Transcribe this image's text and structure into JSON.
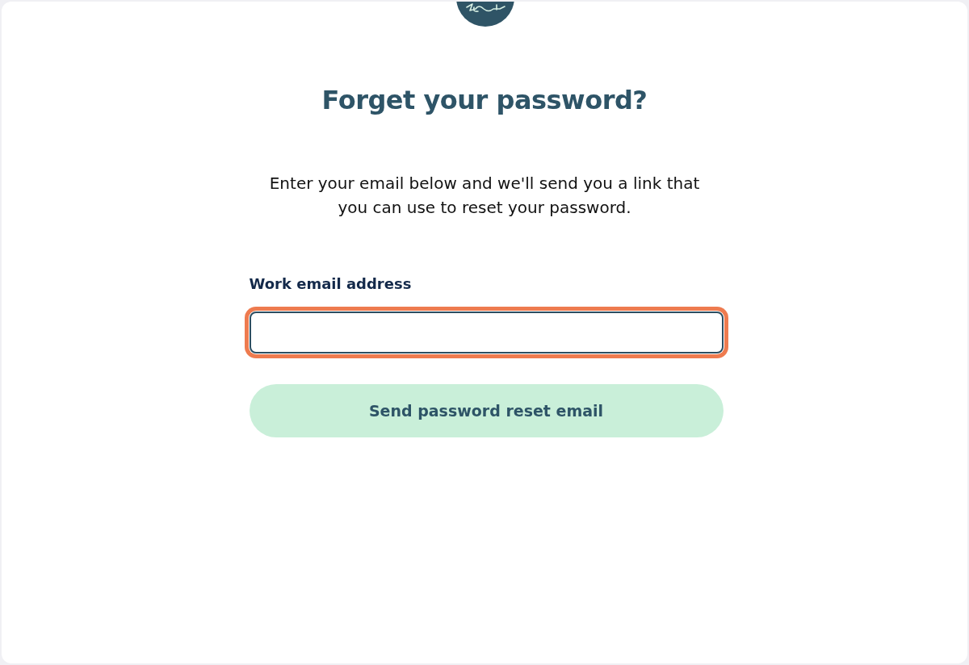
{
  "heading": "Forget your password?",
  "description": "Enter your email below and we'll send you a link that you can use to reset your password.",
  "form": {
    "email_field": {
      "label": "Work email address",
      "highlighted": true
    },
    "submit_button": {
      "label": "Send password reset email"
    }
  }
}
